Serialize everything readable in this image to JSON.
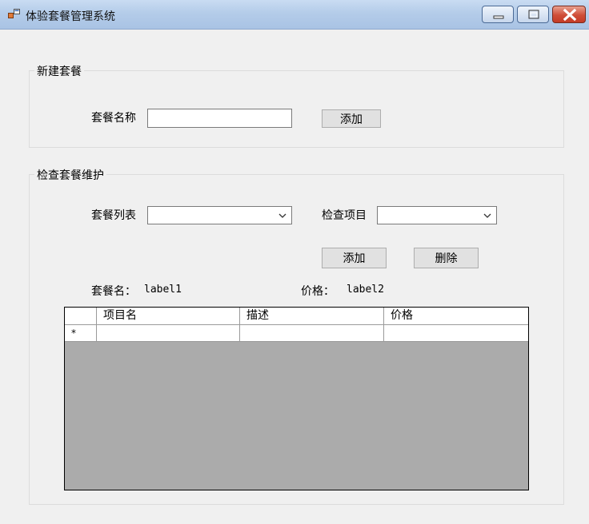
{
  "window": {
    "title": "体验套餐管理系统",
    "icons": [
      "app-icon",
      "minimize-icon",
      "maximize-icon",
      "close-icon"
    ]
  },
  "new_package": {
    "group_title": "新建套餐",
    "name_label": "套餐名称",
    "name_value": "",
    "add_button": "添加"
  },
  "maintenance": {
    "group_title": "检查套餐维护",
    "package_list_label": "套餐列表",
    "package_list_value": "",
    "check_item_label": "检查项目",
    "check_item_value": "",
    "add_button": "添加",
    "delete_button": "删除",
    "package_name_caption": "套餐名：",
    "package_name_value": "label1",
    "price_caption": "价格：",
    "price_value": "label2"
  },
  "grid": {
    "columns": [
      "项目名",
      "描述",
      "价格"
    ],
    "new_row_marker": "*",
    "rows": []
  },
  "colors": {
    "titlebar": "#b4cce9",
    "client_bg": "#f0f0f0",
    "grid_bg": "#ababab",
    "close_button": "#cf4e38"
  }
}
